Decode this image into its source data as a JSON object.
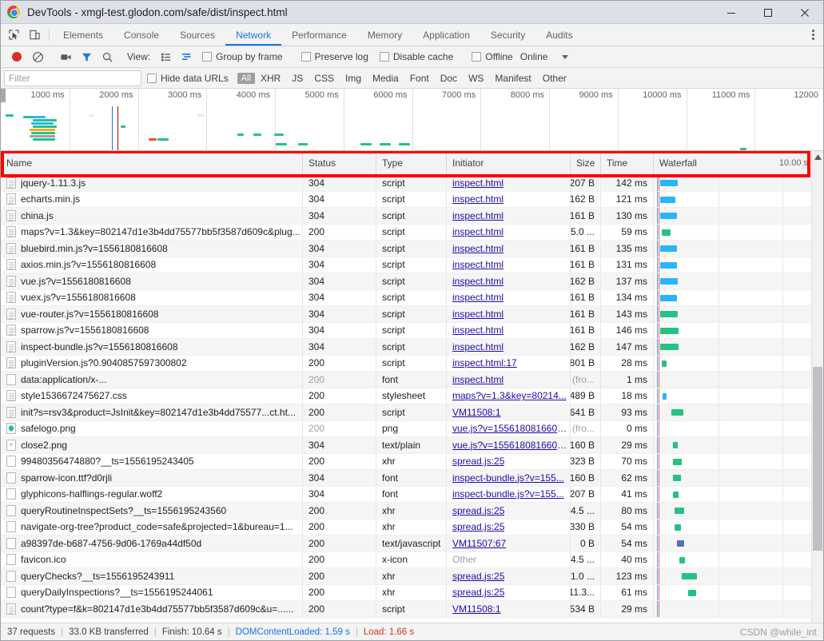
{
  "window": {
    "title": "DevTools - xmgl-test.glodon.com/safe/dist/inspect.html",
    "logo_icon": "chrome-logo",
    "minimize_icon": "minimize-icon",
    "maximize_icon": "maximize-icon",
    "close_icon": "close-icon"
  },
  "tabstrip": {
    "inspect_icon": "inspect-element-icon",
    "device_icon": "device-toolbar-icon",
    "menu_icon": "kebab-menu-icon",
    "tabs": [
      {
        "label": "Elements",
        "active": false
      },
      {
        "label": "Console",
        "active": false
      },
      {
        "label": "Sources",
        "active": false
      },
      {
        "label": "Network",
        "active": true
      },
      {
        "label": "Performance",
        "active": false
      },
      {
        "label": "Memory",
        "active": false
      },
      {
        "label": "Application",
        "active": false
      },
      {
        "label": "Security",
        "active": false
      },
      {
        "label": "Audits",
        "active": false
      }
    ]
  },
  "toolbar": {
    "record_icon": "record-stop-icon",
    "clear_icon": "clear-icon",
    "camera_icon": "capture-screenshots-icon",
    "filter_icon": "filter-icon",
    "search_icon": "search-icon",
    "view_label": "View:",
    "view_list_icon": "view-list-icon",
    "view_waterfall_icon": "view-waterfall-icon",
    "group_by_frame": "Group by frame",
    "preserve_log": "Preserve log",
    "disable_cache": "Disable cache",
    "offline": "Offline",
    "throttling_value": "Online",
    "throttling_caret_icon": "chevron-down-icon"
  },
  "filterbar": {
    "placeholder": "Filter",
    "value": "",
    "hide_data_urls": "Hide data URLs",
    "types": [
      {
        "label": "All",
        "active": true
      },
      {
        "label": "XHR",
        "active": false
      },
      {
        "label": "JS",
        "active": false
      },
      {
        "label": "CSS",
        "active": false
      },
      {
        "label": "Img",
        "active": false
      },
      {
        "label": "Media",
        "active": false
      },
      {
        "label": "Font",
        "active": false
      },
      {
        "label": "Doc",
        "active": false
      },
      {
        "label": "WS",
        "active": false
      },
      {
        "label": "Manifest",
        "active": false
      },
      {
        "label": "Other",
        "active": false
      }
    ]
  },
  "overview": {
    "ticks": [
      "1000 ms",
      "2000 ms",
      "3000 ms",
      "4000 ms",
      "5000 ms",
      "6000 ms",
      "7000 ms",
      "8000 ms",
      "9000 ms",
      "10000 ms",
      "11000 ms",
      "12000"
    ],
    "dom_content_loaded_color": "#1a73e8",
    "load_color": "#a50e0e"
  },
  "table": {
    "columns": [
      {
        "key": "name",
        "label": "Name"
      },
      {
        "key": "status",
        "label": "Status"
      },
      {
        "key": "type",
        "label": "Type"
      },
      {
        "key": "initiator",
        "label": "Initiator"
      },
      {
        "key": "size",
        "label": "Size"
      },
      {
        "key": "time",
        "label": "Time"
      },
      {
        "key": "waterfall",
        "label": "Waterfall"
      }
    ],
    "waterfall_scale": "10.00 s",
    "sort_icon": "sort-ascending-icon",
    "rows": [
      {
        "icon": "document-icon",
        "name": "jquery-1.11.3.js",
        "status": "304",
        "type": "script",
        "initiator": "inspect.html",
        "initiator_link": true,
        "size": "207 B",
        "time": "142 ms",
        "bar": {
          "left": 0.5,
          "width": 1.4,
          "color": "#29b6f6"
        }
      },
      {
        "icon": "document-icon",
        "name": "echarts.min.js",
        "status": "304",
        "type": "script",
        "initiator": "inspect.html",
        "initiator_link": true,
        "size": "162 B",
        "time": "121 ms",
        "bar": {
          "left": 0.5,
          "width": 1.2,
          "color": "#29b6f6"
        }
      },
      {
        "icon": "document-icon",
        "name": "china.js",
        "status": "304",
        "type": "script",
        "initiator": "inspect.html",
        "initiator_link": true,
        "size": "161 B",
        "time": "130 ms",
        "bar": {
          "left": 0.5,
          "width": 1.3,
          "color": "#29b6f6"
        }
      },
      {
        "icon": "document-icon",
        "name": "maps?v=1.3&key=802147d1e3b4dd75577bb5f3587d609c&plug...",
        "status": "200",
        "type": "script",
        "initiator": "inspect.html",
        "initiator_link": true,
        "size": "5.0 ...",
        "time": "59 ms",
        "bar": {
          "left": 0.6,
          "width": 0.7,
          "color": "#26c281"
        }
      },
      {
        "icon": "document-icon",
        "name": "bluebird.min.js?v=1556180816608",
        "status": "304",
        "type": "script",
        "initiator": "inspect.html",
        "initiator_link": true,
        "size": "161 B",
        "time": "135 ms",
        "bar": {
          "left": 0.5,
          "width": 1.3,
          "color": "#29b6f6"
        }
      },
      {
        "icon": "document-icon",
        "name": "axios.min.js?v=1556180816608",
        "status": "304",
        "type": "script",
        "initiator": "inspect.html",
        "initiator_link": true,
        "size": "161 B",
        "time": "131 ms",
        "bar": {
          "left": 0.5,
          "width": 1.3,
          "color": "#29b6f6"
        }
      },
      {
        "icon": "document-icon",
        "name": "vue.js?v=1556180816608",
        "status": "304",
        "type": "script",
        "initiator": "inspect.html",
        "initiator_link": true,
        "size": "162 B",
        "time": "137 ms",
        "bar": {
          "left": 0.5,
          "width": 1.35,
          "color": "#29b6f6"
        }
      },
      {
        "icon": "document-icon",
        "name": "vuex.js?v=1556180816608",
        "status": "304",
        "type": "script",
        "initiator": "inspect.html",
        "initiator_link": true,
        "size": "161 B",
        "time": "134 ms",
        "bar": {
          "left": 0.5,
          "width": 1.3,
          "color": "#29b6f6"
        }
      },
      {
        "icon": "document-icon",
        "name": "vue-router.js?v=1556180816608",
        "status": "304",
        "type": "script",
        "initiator": "inspect.html",
        "initiator_link": true,
        "size": "161 B",
        "time": "143 ms",
        "bar": {
          "left": 0.5,
          "width": 1.4,
          "color": "#26c281"
        }
      },
      {
        "icon": "document-icon",
        "name": "sparrow.js?v=1556180816608",
        "status": "304",
        "type": "script",
        "initiator": "inspect.html",
        "initiator_link": true,
        "size": "161 B",
        "time": "146 ms",
        "bar": {
          "left": 0.5,
          "width": 1.45,
          "color": "#26c281"
        }
      },
      {
        "icon": "document-icon",
        "name": "inspect-bundle.js?v=1556180816608",
        "status": "304",
        "type": "script",
        "initiator": "inspect.html",
        "initiator_link": true,
        "size": "162 B",
        "time": "147 ms",
        "bar": {
          "left": 0.5,
          "width": 1.45,
          "color": "#26c281"
        }
      },
      {
        "icon": "document-icon",
        "name": "pluginVersion.js?0.9040857597300802",
        "status": "200",
        "type": "script",
        "initiator": "inspect.html:17",
        "initiator_link": true,
        "size": "801 B",
        "time": "28 ms",
        "bar": {
          "left": 0.6,
          "width": 0.4,
          "color": "#26c281"
        }
      },
      {
        "icon": "plain-icon",
        "name": "data:application/x-...",
        "status": "200",
        "status_dim": true,
        "type": "font",
        "initiator": "inspect.html",
        "initiator_link": true,
        "size": "(fro...",
        "size_dim": true,
        "time": "1 ms",
        "bar": null
      },
      {
        "icon": "document-icon",
        "name": "style1536672475627.css",
        "status": "200",
        "type": "stylesheet",
        "initiator": "maps?v=1.3&key=80214...",
        "initiator_link": true,
        "size": "489 B",
        "time": "18 ms",
        "bar": {
          "left": 0.7,
          "width": 0.3,
          "color": "#29b6f6"
        }
      },
      {
        "icon": "document-icon",
        "name": "init?s=rsv3&product=JsInit&key=802147d1e3b4dd75577...ct.ht...",
        "status": "200",
        "type": "script",
        "initiator": "VM11508:1",
        "initiator_link": true,
        "size": "641 B",
        "time": "93 ms",
        "bar": {
          "left": 1.4,
          "width": 0.9,
          "color": "#26c281"
        }
      },
      {
        "icon": "shield-icon",
        "name": "safelogo.png",
        "status": "200",
        "status_dim": true,
        "type": "png",
        "initiator": "vue.js?v=1556180816608...",
        "initiator_link": true,
        "size": "(fro...",
        "size_dim": true,
        "time": "0 ms",
        "bar": null
      },
      {
        "icon": "broken-image-icon",
        "name": "close2.png",
        "status": "304",
        "type": "text/plain",
        "initiator": "vue.js?v=1556180816608...",
        "initiator_link": true,
        "size": "160 B",
        "time": "29 ms",
        "bar": {
          "left": 1.5,
          "width": 0.4,
          "color": "#26c281"
        }
      },
      {
        "icon": "plain-icon",
        "name": "99480356474880?__ts=1556195243405",
        "status": "200",
        "type": "xhr",
        "initiator": "spread.js:25",
        "initiator_link": true,
        "size": "323 B",
        "time": "70 ms",
        "bar": {
          "left": 1.5,
          "width": 0.7,
          "color": "#26c281"
        }
      },
      {
        "icon": "plain-icon",
        "name": "sparrow-icon.ttf?d0rjli",
        "status": "304",
        "type": "font",
        "initiator": "inspect-bundle.js?v=155...",
        "initiator_link": true,
        "size": "160 B",
        "time": "62 ms",
        "bar": {
          "left": 1.5,
          "width": 0.6,
          "color": "#26c281"
        }
      },
      {
        "icon": "plain-icon",
        "name": "glyphicons-halflings-regular.woff2",
        "status": "304",
        "type": "font",
        "initiator": "inspect-bundle.js?v=155...",
        "initiator_link": true,
        "size": "207 B",
        "time": "41 ms",
        "bar": {
          "left": 1.5,
          "width": 0.45,
          "color": "#26c281"
        }
      },
      {
        "icon": "plain-icon",
        "name": "queryRoutineInspectSets?__ts=1556195243560",
        "status": "200",
        "type": "xhr",
        "initiator": "spread.js:25",
        "initiator_link": true,
        "size": "4.5 ...",
        "time": "80 ms",
        "bar": {
          "left": 1.6,
          "width": 0.8,
          "color": "#26c281"
        }
      },
      {
        "icon": "plain-icon",
        "name": "navigate-org-tree?product_code=safe&projected=1&bureau=1...",
        "status": "200",
        "type": "xhr",
        "initiator": "spread.js:25",
        "initiator_link": true,
        "size": "330 B",
        "time": "54 ms",
        "bar": {
          "left": 1.6,
          "width": 0.55,
          "color": "#26c281"
        }
      },
      {
        "icon": "plain-icon",
        "name": "a98397de-b687-4756-9d06-1769a44df50d",
        "status": "200",
        "type": "text/javascript",
        "initiator": "VM11507:67",
        "initiator_link": true,
        "size": "0 B",
        "time": "54 ms",
        "bar": {
          "left": 1.8,
          "width": 0.55,
          "color": "#5c6bc0"
        }
      },
      {
        "icon": "plain-icon",
        "name": "favicon.ico",
        "status": "200",
        "type": "x-icon",
        "initiator": "Other",
        "initiator_link": false,
        "size": "4.5 ...",
        "time": "40 ms",
        "bar": {
          "left": 2.0,
          "width": 0.45,
          "color": "#26c281"
        }
      },
      {
        "icon": "plain-icon",
        "name": "queryChecks?__ts=1556195243911",
        "status": "200",
        "type": "xhr",
        "initiator": "spread.js:25",
        "initiator_link": true,
        "size": "1.0 ...",
        "time": "123 ms",
        "bar": {
          "left": 2.2,
          "width": 1.2,
          "color": "#26c281"
        }
      },
      {
        "icon": "plain-icon",
        "name": "queryDailyInspections?__ts=1556195244061",
        "status": "200",
        "type": "xhr",
        "initiator": "spread.js:25",
        "initiator_link": true,
        "size": "11.3...",
        "time": "61 ms",
        "bar": {
          "left": 2.7,
          "width": 0.6,
          "color": "#26c281"
        }
      },
      {
        "icon": "document-icon",
        "name": "count?type=f&k=802147d1e3b4dd75577bb5f3587d609c&u=......",
        "status": "200",
        "type": "script",
        "initiator": "VM11508:1",
        "initiator_link": true,
        "size": "534 B",
        "time": "29 ms",
        "bar": null
      }
    ]
  },
  "statusbar": {
    "requests": "37 requests",
    "transferred": "33.0 KB transferred",
    "finish": "Finish: 10.64 s",
    "dom_content_loaded": "DOMContentLoaded: 1.59 s",
    "load": "Load: 1.66 s",
    "watermark": "CSDN @while_int"
  },
  "annotation": {
    "highlight_color": "#ff0000"
  }
}
